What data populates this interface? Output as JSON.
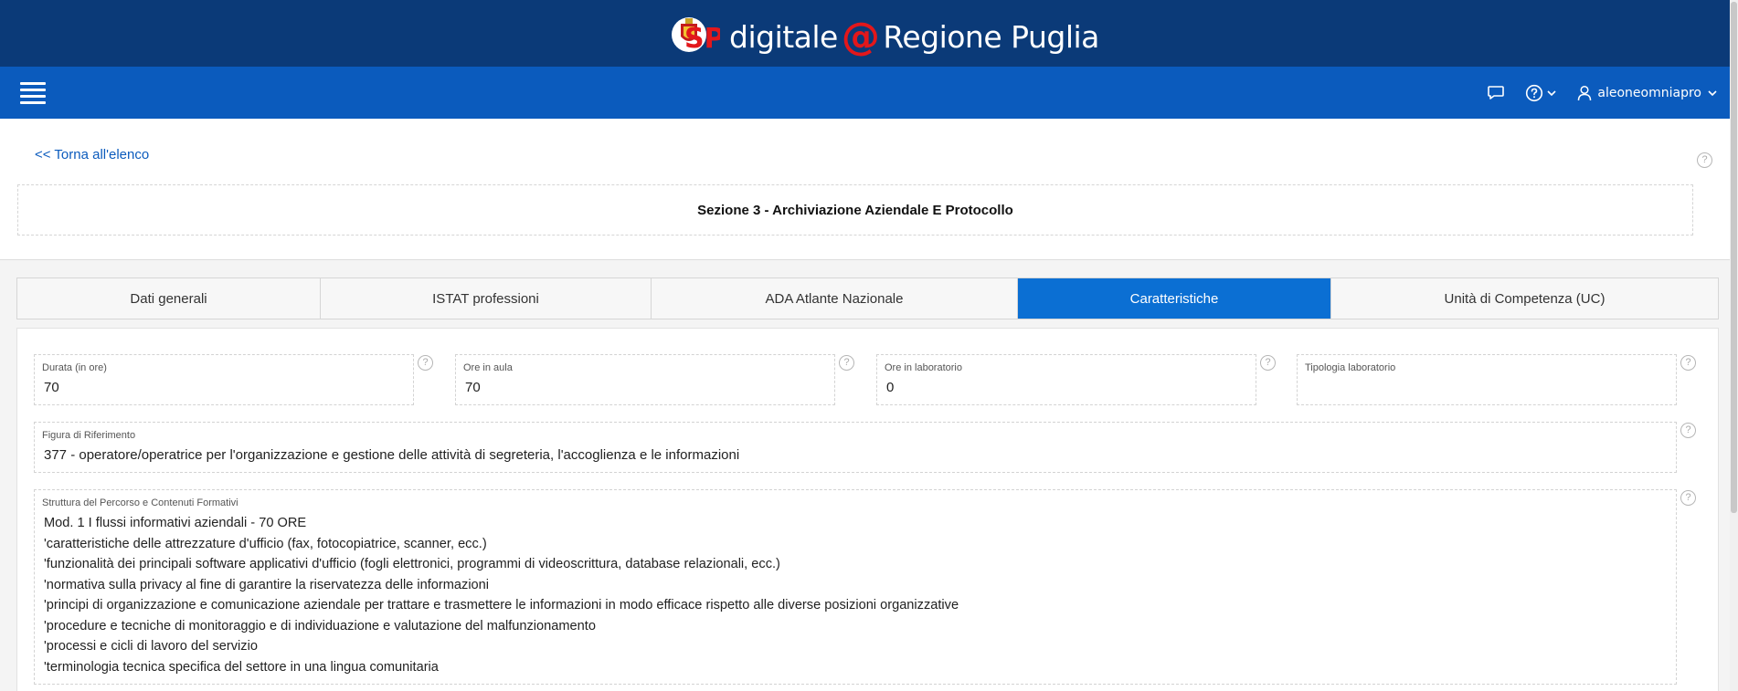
{
  "brand": {
    "logo_initials": "SP",
    "text_left": "digitale",
    "text_at": "@",
    "text_right": "Regione Puglia"
  },
  "navbar": {
    "username": "aleoneomniapro"
  },
  "header": {
    "back_link": "<< Torna all'elenco",
    "title": "Sezione 3 - Archiviazione Aziendale E Protocollo"
  },
  "tabs": [
    {
      "label": "Dati generali",
      "active": false
    },
    {
      "label": "ISTAT professioni",
      "active": false
    },
    {
      "label": "ADA Atlante Nazionale",
      "active": false
    },
    {
      "label": "Caratteristiche",
      "active": true
    },
    {
      "label": "Unità di Competenza (UC)",
      "active": false
    }
  ],
  "form": {
    "durata": {
      "label": "Durata (in ore)",
      "value": "70"
    },
    "ore_aula": {
      "label": "Ore in aula",
      "value": "70"
    },
    "ore_laboratorio": {
      "label": "Ore in laboratorio",
      "value": "0"
    },
    "tipologia_laboratorio": {
      "label": "Tipologia laboratorio",
      "value": ""
    },
    "figura": {
      "label": "Figura di Riferimento",
      "value": "377 - operatore/operatrice per l'organizzazione e gestione delle attività di segreteria, l'accoglienza e le informazioni"
    },
    "struttura": {
      "label": "Struttura del Percorso e Contenuti Formativi",
      "lines": [
        "Mod. 1 I flussi informativi aziendali - 70 ORE",
        "'caratteristiche delle attrezzature d'ufficio (fax, fotocopiatrice, scanner, ecc.)",
        "'funzionalità dei principali software applicativi d'ufficio (fogli elettronici, programmi di videoscrittura, database relazionali, ecc.)",
        "'normativa sulla privacy al fine di garantire la riservatezza delle informazioni",
        "'principi di organizzazione e comunicazione aziendale per trattare e trasmettere le informazioni in modo efficace rispetto alle diverse posizioni organizzative",
        "'procedure e tecniche di monitoraggio e di individuazione e valutazione del malfunzionamento",
        "'processi e cicli di lavoro del servizio",
        "'terminologia tecnica specifica del settore in una lingua comunitaria"
      ]
    }
  },
  "help_glyph": "?",
  "colors": {
    "topbar": "#0b3a78",
    "navbar": "#0b5bbd",
    "active_tab": "#0b6fd3",
    "at_sign": "#e3171b"
  }
}
